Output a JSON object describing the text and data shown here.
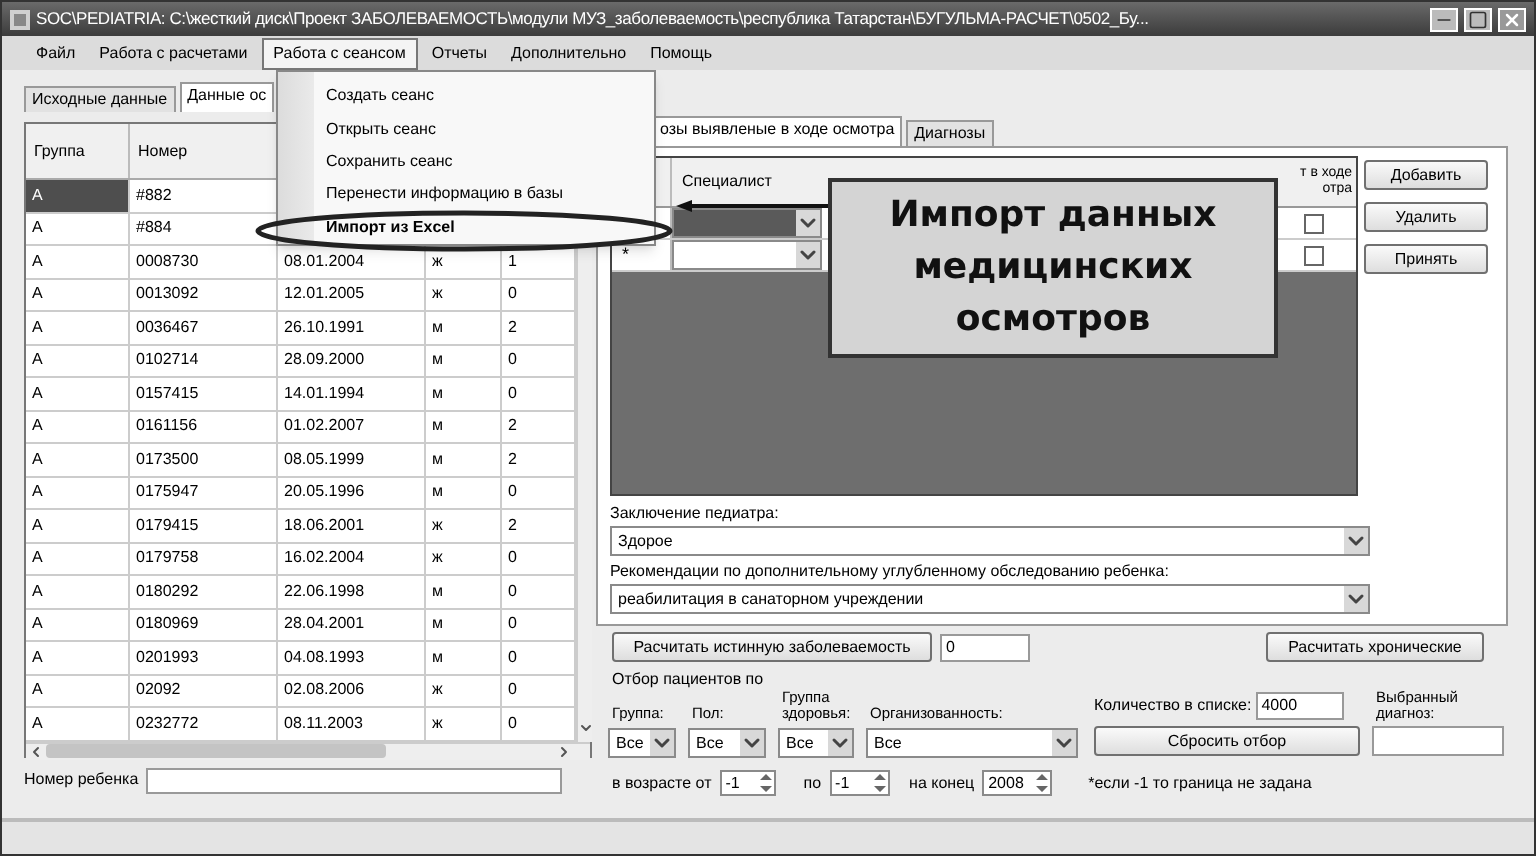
{
  "window": {
    "title": "SOC\\PEDIATRIA: C:\\жесткий диск\\Проект ЗАБОЛЕВАЕМОСТЬ\\модули МУЗ_заболеваемость\\республика Татарстан\\БУГУЛЬМА-РАСЧЕТ\\0502_Бу..."
  },
  "menu": [
    {
      "label": "Файл",
      "selected": false
    },
    {
      "label": "Работа с расчетами",
      "selected": false
    },
    {
      "label": "Работа с сеансом",
      "selected": true
    },
    {
      "label": "Отчеты",
      "selected": false
    },
    {
      "label": "Дополнительно",
      "selected": false
    },
    {
      "label": "Помощь",
      "selected": false
    }
  ],
  "dropdown_menu": {
    "items": [
      {
        "label": "Создать сеанс",
        "highlighted": false
      },
      {
        "label": "Открыть сеанс",
        "highlighted": false
      },
      {
        "label": "Сохранить сеанс",
        "highlighted": false
      },
      {
        "label": "Перенести информацию в базы",
        "highlighted": false
      },
      {
        "label": "Импорт из Excel",
        "highlighted": true
      }
    ]
  },
  "callout": "Импорт данных медицинских осмотров",
  "left_tabs": [
    {
      "label": "Исходные данные",
      "selected": false
    },
    {
      "label": "Данные ос",
      "selected": true
    }
  ],
  "patients_table": {
    "columns": [
      "Группа",
      "Номер"
    ],
    "rows": [
      {
        "cells": [
          "А",
          "#882"
        ],
        "selected": true
      },
      {
        "cells": [
          "А",
          "#884"
        ],
        "selected": false
      },
      {
        "cells": [
          "А",
          "0008730",
          "08.01.2004",
          "ж",
          "1"
        ],
        "selected": false
      },
      {
        "cells": [
          "А",
          "0013092",
          "12.01.2005",
          "ж",
          "0"
        ],
        "selected": false
      },
      {
        "cells": [
          "А",
          "0036467",
          "26.10.1991",
          "м",
          "2"
        ],
        "selected": false
      },
      {
        "cells": [
          "А",
          "0102714",
          "28.09.2000",
          "м",
          "0"
        ],
        "selected": false
      },
      {
        "cells": [
          "А",
          "0157415",
          "14.01.1994",
          "м",
          "0"
        ],
        "selected": false
      },
      {
        "cells": [
          "А",
          "0161156",
          "01.02.2007",
          "м",
          "2"
        ],
        "selected": false
      },
      {
        "cells": [
          "А",
          "0173500",
          "08.05.1999",
          "м",
          "2"
        ],
        "selected": false
      },
      {
        "cells": [
          "А",
          "0175947",
          "20.05.1996",
          "м",
          "0"
        ],
        "selected": false
      },
      {
        "cells": [
          "А",
          "0179415",
          "18.06.2001",
          "ж",
          "2"
        ],
        "selected": false
      },
      {
        "cells": [
          "А",
          "0179758",
          "16.02.2004",
          "ж",
          "0"
        ],
        "selected": false
      },
      {
        "cells": [
          "А",
          "0180292",
          "22.06.1998",
          "м",
          "0"
        ],
        "selected": false
      },
      {
        "cells": [
          "А",
          "0180969",
          "28.04.2001",
          "м",
          "0"
        ],
        "selected": false
      },
      {
        "cells": [
          "А",
          "0201993",
          "04.08.1993",
          "м",
          "0"
        ],
        "selected": false
      },
      {
        "cells": [
          "А",
          "02092",
          "02.08.2006",
          "ж",
          "0"
        ],
        "selected": false
      },
      {
        "cells": [
          "А",
          "0232772",
          "08.11.2003",
          "ж",
          "0"
        ],
        "selected": false
      }
    ]
  },
  "child_number": {
    "label": "Номер ребенка"
  },
  "right_tabs": [
    {
      "label": "озы выявленые в ходе осмотра",
      "selected": true
    },
    {
      "label": "Диагнозы",
      "selected": false
    }
  ],
  "exam_grid": {
    "columns": [
      "Специалист",
      "т в ходе отра"
    ],
    "rows": [
      {
        "selected": true,
        "checked": false
      },
      {
        "marker": "*",
        "selected": false,
        "checked": false
      }
    ]
  },
  "grid_buttons": [
    "Добавить",
    "Удалить",
    "Принять"
  ],
  "conclusion": {
    "label": "Заключение педиатра:",
    "value": "Здорое"
  },
  "recommendation": {
    "label": "Рекомендации по дополнительному углубленному обследованию ребенка:",
    "value": "реабилитация в санаторном учреждении"
  },
  "calc_button": "Расчитать истинную заболеваемость",
  "calc_value": "0",
  "chronic_button": "Расчитать хронические",
  "filter": {
    "title": "Отбор пациентов по",
    "fields": [
      {
        "label": "Группа:",
        "value": "Все"
      },
      {
        "label": "Пол:",
        "value": "Все"
      },
      {
        "label": "Группа здоровья:",
        "value": "Все"
      },
      {
        "label": "Организованность:",
        "value": "Все"
      }
    ],
    "count_label": "Количество в списке:",
    "count": "4000",
    "reset_button": "Сбросить отбор",
    "diagnosis_label": "Выбранный диагноз:",
    "age_from_label": "в возрасте от",
    "age_from": "-1",
    "age_to_label": "по",
    "age_to": "-1",
    "year_label": "на конец",
    "year": "2008",
    "note": "*если -1 то граница не задана"
  }
}
